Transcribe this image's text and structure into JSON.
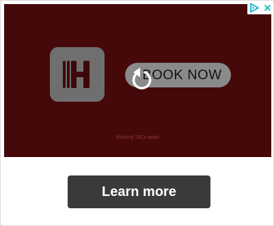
{
  "ad": {
    "cta_label": "BOOK NOW",
    "fineprint": "Booking T&Cs apply",
    "learn_more_label": "Learn more"
  },
  "colors": {
    "hero_background": "#4b0a0a",
    "app_icon_background": "#6f6f6f",
    "cta_pill_background": "#8a8a8a",
    "learn_more_background": "#3a3a3a",
    "adchoices_accent": "#00aecd"
  },
  "icons": {
    "app_logo": "h-letter-logo-icon",
    "replay": "replay-icon",
    "adchoices": "adchoices-icon",
    "close": "close-icon"
  }
}
